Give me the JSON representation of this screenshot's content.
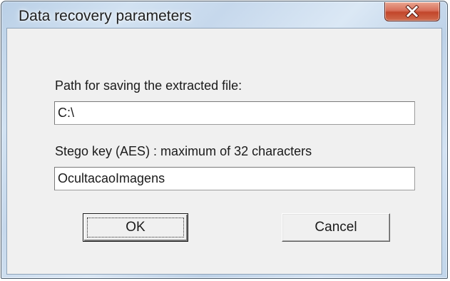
{
  "window": {
    "title": "Data recovery parameters",
    "close_icon": "close-x-icon",
    "close_button_color": "#c94a30"
  },
  "form": {
    "path_label": "Path for saving the extracted file:",
    "path_value": "C:\\",
    "key_label": "Stego key (AES) : maximum of 32 characters",
    "key_value": "OcultacaoImagens"
  },
  "buttons": {
    "ok_label": "OK",
    "cancel_label": "Cancel"
  }
}
